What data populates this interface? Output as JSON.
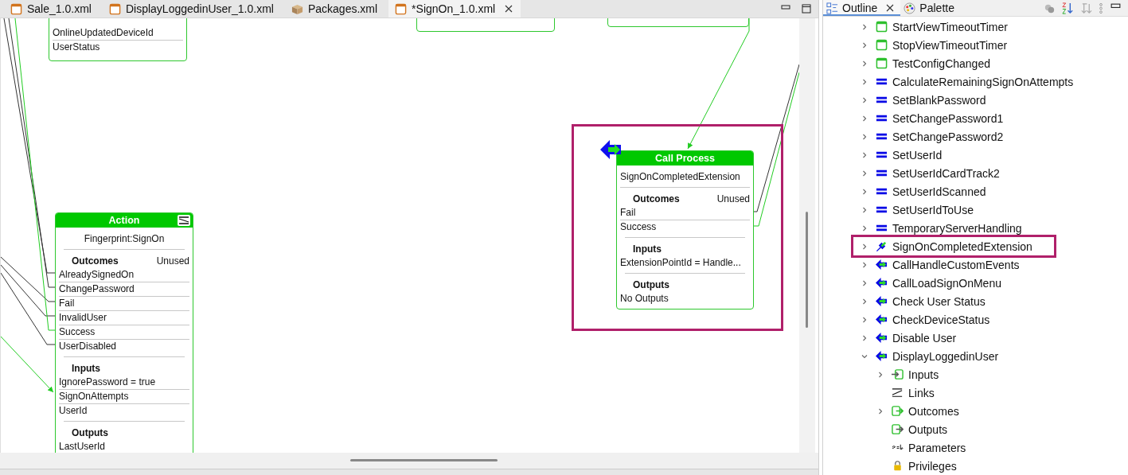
{
  "editor_tabs": [
    {
      "label": "Sale_1.0.xml",
      "kind": "editor",
      "selected": false
    },
    {
      "label": "DisplayLoggedinUser_1.0.xml",
      "kind": "editor",
      "selected": false
    },
    {
      "label": "Packages.xml",
      "kind": "package",
      "selected": false
    },
    {
      "label": "*SignOn_1.0.xml",
      "kind": "editor",
      "selected": true
    }
  ],
  "diagram": {
    "nodes": [
      {
        "kind": "fragment",
        "rows": [
          "OnlineUpdatedDeviceId",
          "UserStatus"
        ]
      },
      {
        "kind": "fragment"
      },
      {
        "kind": "fragment"
      },
      {
        "kind": "action",
        "header": "Action",
        "subtitle": "Fingerprint:SignOn",
        "sections": [
          {
            "title": "Outcomes",
            "note": "Unused",
            "rows": [
              "AlreadySignedOn",
              "ChangePassword",
              "Fail",
              "InvalidUser",
              "Success",
              "UserDisabled"
            ]
          },
          {
            "title": "Inputs",
            "rows": [
              "IgnorePassword = true",
              "SignOnAttempts",
              "UserId"
            ]
          },
          {
            "title": "Outputs",
            "rows": [
              "LastUserId"
            ]
          }
        ]
      },
      {
        "kind": "call_process",
        "header": "Call Process",
        "subtitle": "SignOnCompletedExtension",
        "highlighted": true,
        "sections": [
          {
            "title": "Outcomes",
            "note": "Unused",
            "rows": [
              "Fail",
              "Success"
            ]
          },
          {
            "title": "Inputs",
            "rows": [
              "ExtensionPointId = Handle..."
            ]
          },
          {
            "title": "Outputs",
            "rows": [
              "No Outputs"
            ]
          }
        ]
      }
    ]
  },
  "side_tabs": [
    {
      "label": "Outline",
      "kind": "outline",
      "selected": true
    },
    {
      "label": "Palette",
      "kind": "palette",
      "selected": false
    }
  ],
  "outline": [
    {
      "label": "StartViewTimeoutTimer",
      "kind": "timer",
      "expandable": true,
      "expanded": false
    },
    {
      "label": "StopViewTimeoutTimer",
      "kind": "timer",
      "expandable": true,
      "expanded": false
    },
    {
      "label": "TestConfigChanged",
      "kind": "timer",
      "expandable": true,
      "expanded": false
    },
    {
      "label": "CalculateRemainingSignOnAttempts",
      "kind": "assign",
      "expandable": true,
      "expanded": false
    },
    {
      "label": "SetBlankPassword",
      "kind": "assign",
      "expandable": true,
      "expanded": false
    },
    {
      "label": "SetChangePassword1",
      "kind": "assign",
      "expandable": true,
      "expanded": false
    },
    {
      "label": "SetChangePassword2",
      "kind": "assign",
      "expandable": true,
      "expanded": false
    },
    {
      "label": "SetUserId",
      "kind": "assign",
      "expandable": true,
      "expanded": false
    },
    {
      "label": "SetUserIdCardTrack2",
      "kind": "assign",
      "expandable": true,
      "expanded": false
    },
    {
      "label": "SetUserIdScanned",
      "kind": "assign",
      "expandable": true,
      "expanded": false
    },
    {
      "label": "SetUserIdToUse",
      "kind": "assign",
      "expandable": true,
      "expanded": false
    },
    {
      "label": "TemporaryServerHandling",
      "kind": "assign",
      "expandable": true,
      "expanded": false
    },
    {
      "label": "SignOnCompletedExtension",
      "kind": "extension",
      "expandable": true,
      "expanded": false,
      "highlighted": true
    },
    {
      "label": "CallHandleCustomEvents",
      "kind": "call",
      "expandable": true,
      "expanded": false
    },
    {
      "label": "CallLoadSignOnMenu",
      "kind": "call",
      "expandable": true,
      "expanded": false
    },
    {
      "label": "Check User Status",
      "kind": "call",
      "expandable": true,
      "expanded": false
    },
    {
      "label": "CheckDeviceStatus",
      "kind": "call",
      "expandable": true,
      "expanded": false
    },
    {
      "label": "Disable User",
      "kind": "call",
      "expandable": true,
      "expanded": false
    },
    {
      "label": "DisplayLoggedinUser",
      "kind": "call",
      "expandable": true,
      "expanded": true,
      "children": [
        {
          "label": "Inputs",
          "kind": "inputs",
          "expandable": true,
          "expanded": false
        },
        {
          "label": "Links",
          "kind": "links",
          "expandable": false
        },
        {
          "label": "Outcomes",
          "kind": "outcomes",
          "expandable": true,
          "expanded": false
        },
        {
          "label": "Outputs",
          "kind": "outputs",
          "expandable": false
        },
        {
          "label": "Parameters",
          "kind": "parameters",
          "expandable": false
        },
        {
          "label": "Privileges",
          "kind": "privileges",
          "expandable": false
        }
      ]
    }
  ]
}
